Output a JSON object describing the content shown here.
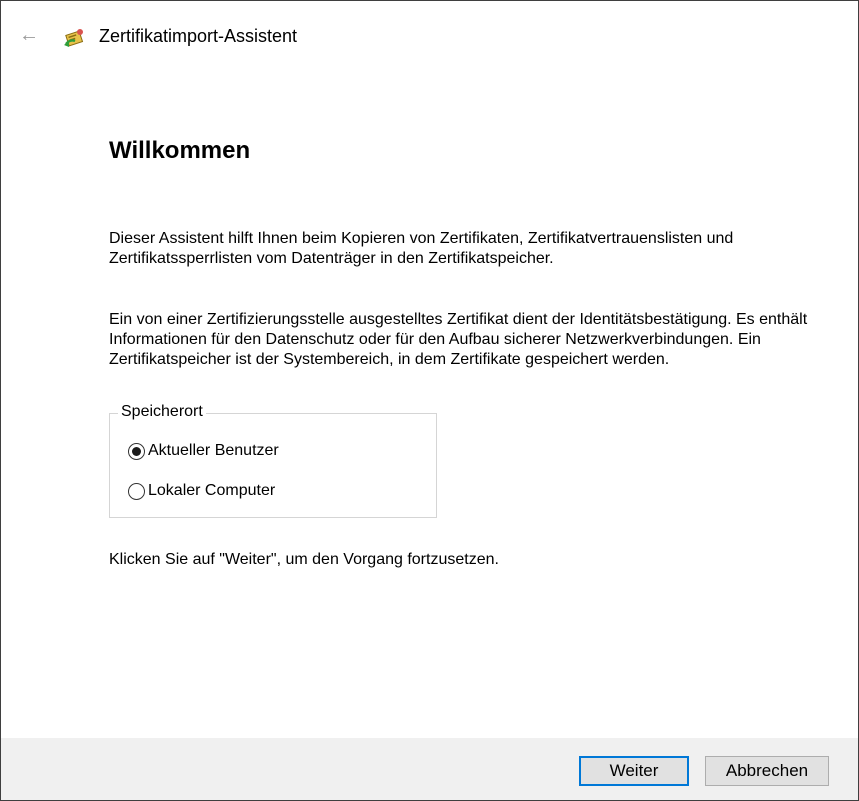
{
  "window": {
    "title": "Zertifikatimport-Assistent",
    "back_icon": "back-arrow-icon",
    "app_icon": "certificate-icon"
  },
  "main": {
    "heading": "Willkommen",
    "intro": "Dieser Assistent hilft Ihnen beim Kopieren von Zertifikaten, Zertifikatvertrauenslisten und Zertifikatssperrlisten vom Datenträger in den Zertifikatspeicher.",
    "description": "Ein von einer Zertifizierungsstelle ausgestelltes Zertifikat dient der Identitätsbestätigung. Es enthält Informationen für den Datenschutz oder für den Aufbau sicherer Netzwerkverbindungen. Ein Zertifikatspeicher ist der Systembereich, in dem Zertifikate gespeichert werden.",
    "store_location": {
      "legend": "Speicherort",
      "options": [
        {
          "label": "Aktueller Benutzer",
          "selected": true
        },
        {
          "label": "Lokaler Computer",
          "selected": false
        }
      ]
    },
    "continue_hint": "Klicken Sie auf \"Weiter\", um den Vorgang fortzusetzen."
  },
  "footer": {
    "next_label": "Weiter",
    "cancel_label": "Abbrechen"
  },
  "colors": {
    "accent": "#0078d7",
    "footer_bg": "#f0f0f0",
    "button_bg": "#e1e1e1"
  }
}
